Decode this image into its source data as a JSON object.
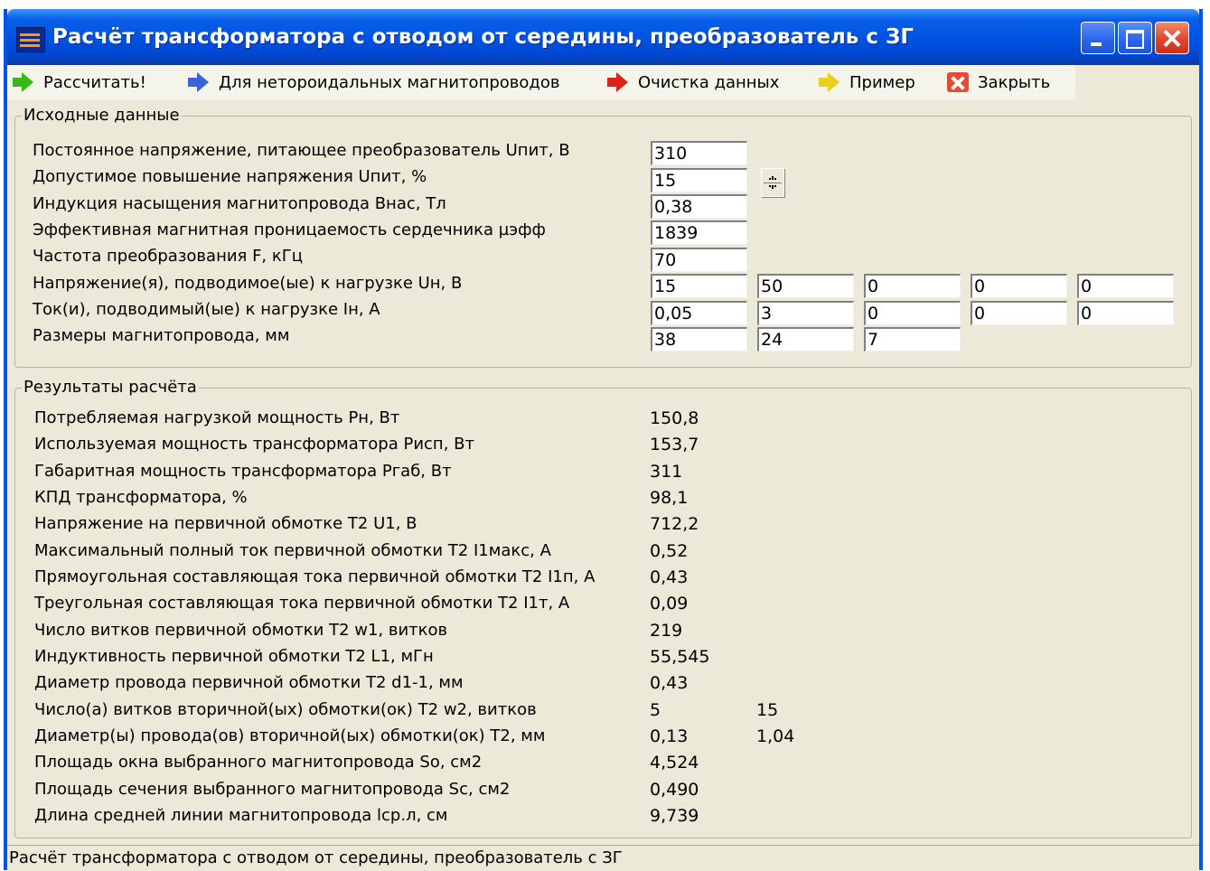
{
  "window": {
    "title": "Расчёт трансформатора с отводом от середины, преобразователь с ЗГ"
  },
  "toolbar": {
    "calculate": "Рассчитать!",
    "non_toroidal": "Для нетороидальных магнитопроводов",
    "clear": "Очистка данных",
    "example": "Пример",
    "close": "Закрыть"
  },
  "input": {
    "legend": "Исходные данные",
    "rows": [
      {
        "label": "Постоянное напряжение, питающее преобразователь Uпит, В",
        "values": [
          "310"
        ]
      },
      {
        "label": "Допустимое повышение напряжения Uпит, %",
        "values": [
          "15"
        ]
      },
      {
        "label": "Индукция насыщения магнитопровода Bнас, Тл",
        "values": [
          "0,38"
        ]
      },
      {
        "label": "Эффективная магнитная проницаемость сердечника µэфф",
        "values": [
          "1839"
        ]
      },
      {
        "label": "Частота преобразования F, кГц",
        "values": [
          "70"
        ]
      },
      {
        "label": "Напряжение(я), подводимое(ые) к нагрузке Uн, В",
        "values": [
          "15",
          "50",
          "0",
          "0",
          "0"
        ]
      },
      {
        "label": "Ток(и), подводимый(ые) к нагрузке Iн, А",
        "values": [
          "0,05",
          "3",
          "0",
          "0",
          "0"
        ]
      },
      {
        "label": "Размеры магнитопровода, мм",
        "values": [
          "38",
          "24",
          "7"
        ]
      }
    ]
  },
  "results": {
    "legend": "Результаты расчёта",
    "rows": [
      {
        "label": "Потребляемая нагрузкой мощность Pн, Вт",
        "values": [
          "150,8"
        ]
      },
      {
        "label": "Используемая мощность трансформатора Pисп, Вт",
        "values": [
          "153,7"
        ]
      },
      {
        "label": "Габаритная мощность трансформатора Pгаб, Вт",
        "values": [
          "311"
        ]
      },
      {
        "label": "КПД трансформатора, %",
        "values": [
          "98,1"
        ]
      },
      {
        "label": "Напряжение на первичной обмотке T2 U1, В",
        "values": [
          "712,2"
        ]
      },
      {
        "label": "Максимальный полный ток первичной обмотки T2 I1макс, А",
        "values": [
          "0,52"
        ]
      },
      {
        "label": "Прямоугольная составляющая тока первичной обмотки T2 I1п, А",
        "values": [
          "0,43"
        ]
      },
      {
        "label": "Треугольная составляющая тока первичной обмотки T2 I1т, А",
        "values": [
          "0,09"
        ]
      },
      {
        "label": "Число витков первичной обмотки T2 w1, витков",
        "values": [
          "219"
        ]
      },
      {
        "label": "Индуктивность первичной обмотки T2 L1, мГн",
        "values": [
          "55,545"
        ]
      },
      {
        "label": "Диаметр провода первичной обмотки T2 d1-1, мм",
        "values": [
          "0,43"
        ]
      },
      {
        "label": "Число(а) витков вторичной(ых) обмотки(ок) T2 w2, витков",
        "values": [
          "5",
          "15"
        ]
      },
      {
        "label": "Диаметр(ы) провода(ов) вторичной(ых) обмотки(ок) T2, мм",
        "values": [
          "0,13",
          "1,04"
        ]
      },
      {
        "label": "Площадь окна выбранного магнитопровода So, см2",
        "values": [
          "4,524"
        ]
      },
      {
        "label": "Площадь сечения выбранного магнитопровода Sc, см2",
        "values": [
          "0,490"
        ]
      },
      {
        "label": "Длина средней линии магнитопровода lср.л, см",
        "values": [
          "9,739"
        ]
      }
    ]
  },
  "statusbar": {
    "text": "Расчёт трансформатора с отводом от середины, преобразователь с ЗГ"
  }
}
